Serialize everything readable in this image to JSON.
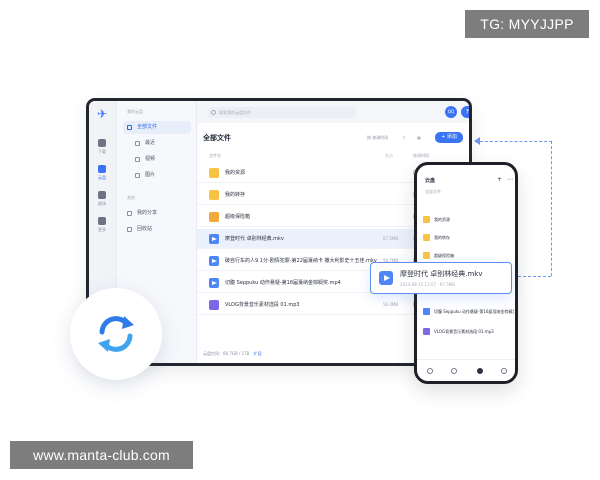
{
  "watermarks": {
    "top_right": "TG: MYYJJPP",
    "bottom_left": "www.manta-club.com"
  },
  "colors": {
    "accent": "#3a74f5",
    "folder": "#f6c343",
    "video": "#4f86f7",
    "music": "#7c68e6",
    "selected_row": "#eaf1fd"
  },
  "rail": {
    "items": [
      {
        "label": "下载",
        "icon": "download-icon"
      },
      {
        "label": "云盘",
        "icon": "cloud-icon",
        "active": true
      },
      {
        "label": "剧场",
        "icon": "theater-icon"
      },
      {
        "label": "更多",
        "icon": "grid-icon"
      }
    ]
  },
  "sidebar": {
    "section_top": "我的云盘",
    "all_files": "全部文件",
    "sub_items": [
      "最近",
      "视频",
      "图片"
    ],
    "section_mid": "其他",
    "share": "我的分享",
    "trash": "回收站"
  },
  "topbar": {
    "search_placeholder": "搜索我的云盘文件",
    "avatar_text": "QQ",
    "vip_label": "开通会员"
  },
  "main": {
    "title": "全部文件",
    "sort_label": "按 修改时间",
    "add_label": "+ 添加",
    "col_name": "文件名",
    "col_size": "大小",
    "col_time": "修改时间",
    "files": [
      {
        "name": "我的资源",
        "kind": "folder",
        "size": ""
      },
      {
        "name": "我的转存",
        "kind": "folder",
        "size": ""
      },
      {
        "name": "超级保险箱",
        "kind": "safe",
        "size": ""
      },
      {
        "name": "摩登时代 卓别林经典.mkv",
        "kind": "video",
        "size": "67.5MB",
        "selected": true
      },
      {
        "name": "破自行车的人9.1分-剧情犯罪-第22届戛纳卡 撒大利影史十五佳.mkv",
        "kind": "video",
        "size": "56.7MB"
      },
      {
        "name": "切腹 Seppuku 动作悬疑-第16届戛纳金棕榈奖.mp4",
        "kind": "video",
        "size": "43.4MB"
      },
      {
        "name": "VLOG背景音乐素材选段 01.mp3",
        "kind": "music",
        "size": "56.0MB"
      }
    ],
    "storage_text": "云盘空间：66.7GB / 1TB",
    "expand_link": "扩容"
  },
  "phone": {
    "title": "云盘",
    "plus": "+",
    "more": "⋯",
    "tab": "全部文件",
    "files": [
      {
        "name": "我的资源",
        "kind": "folder"
      },
      {
        "name": "我的转存",
        "kind": "folder"
      },
      {
        "name": "超级保险箱",
        "kind": "folder"
      },
      {
        "name": "切腹 Seppuku 动作悬疑-第16届戛纳金棕榈奖.mp4",
        "kind": "video"
      },
      {
        "name": "VLOG背景音乐素材选段 01.mp3",
        "kind": "music"
      }
    ]
  },
  "drag_card": {
    "name": "摩登时代 卓别林经典.mkv",
    "meta": "2023-08-15 12:07 · 67.5MB"
  }
}
